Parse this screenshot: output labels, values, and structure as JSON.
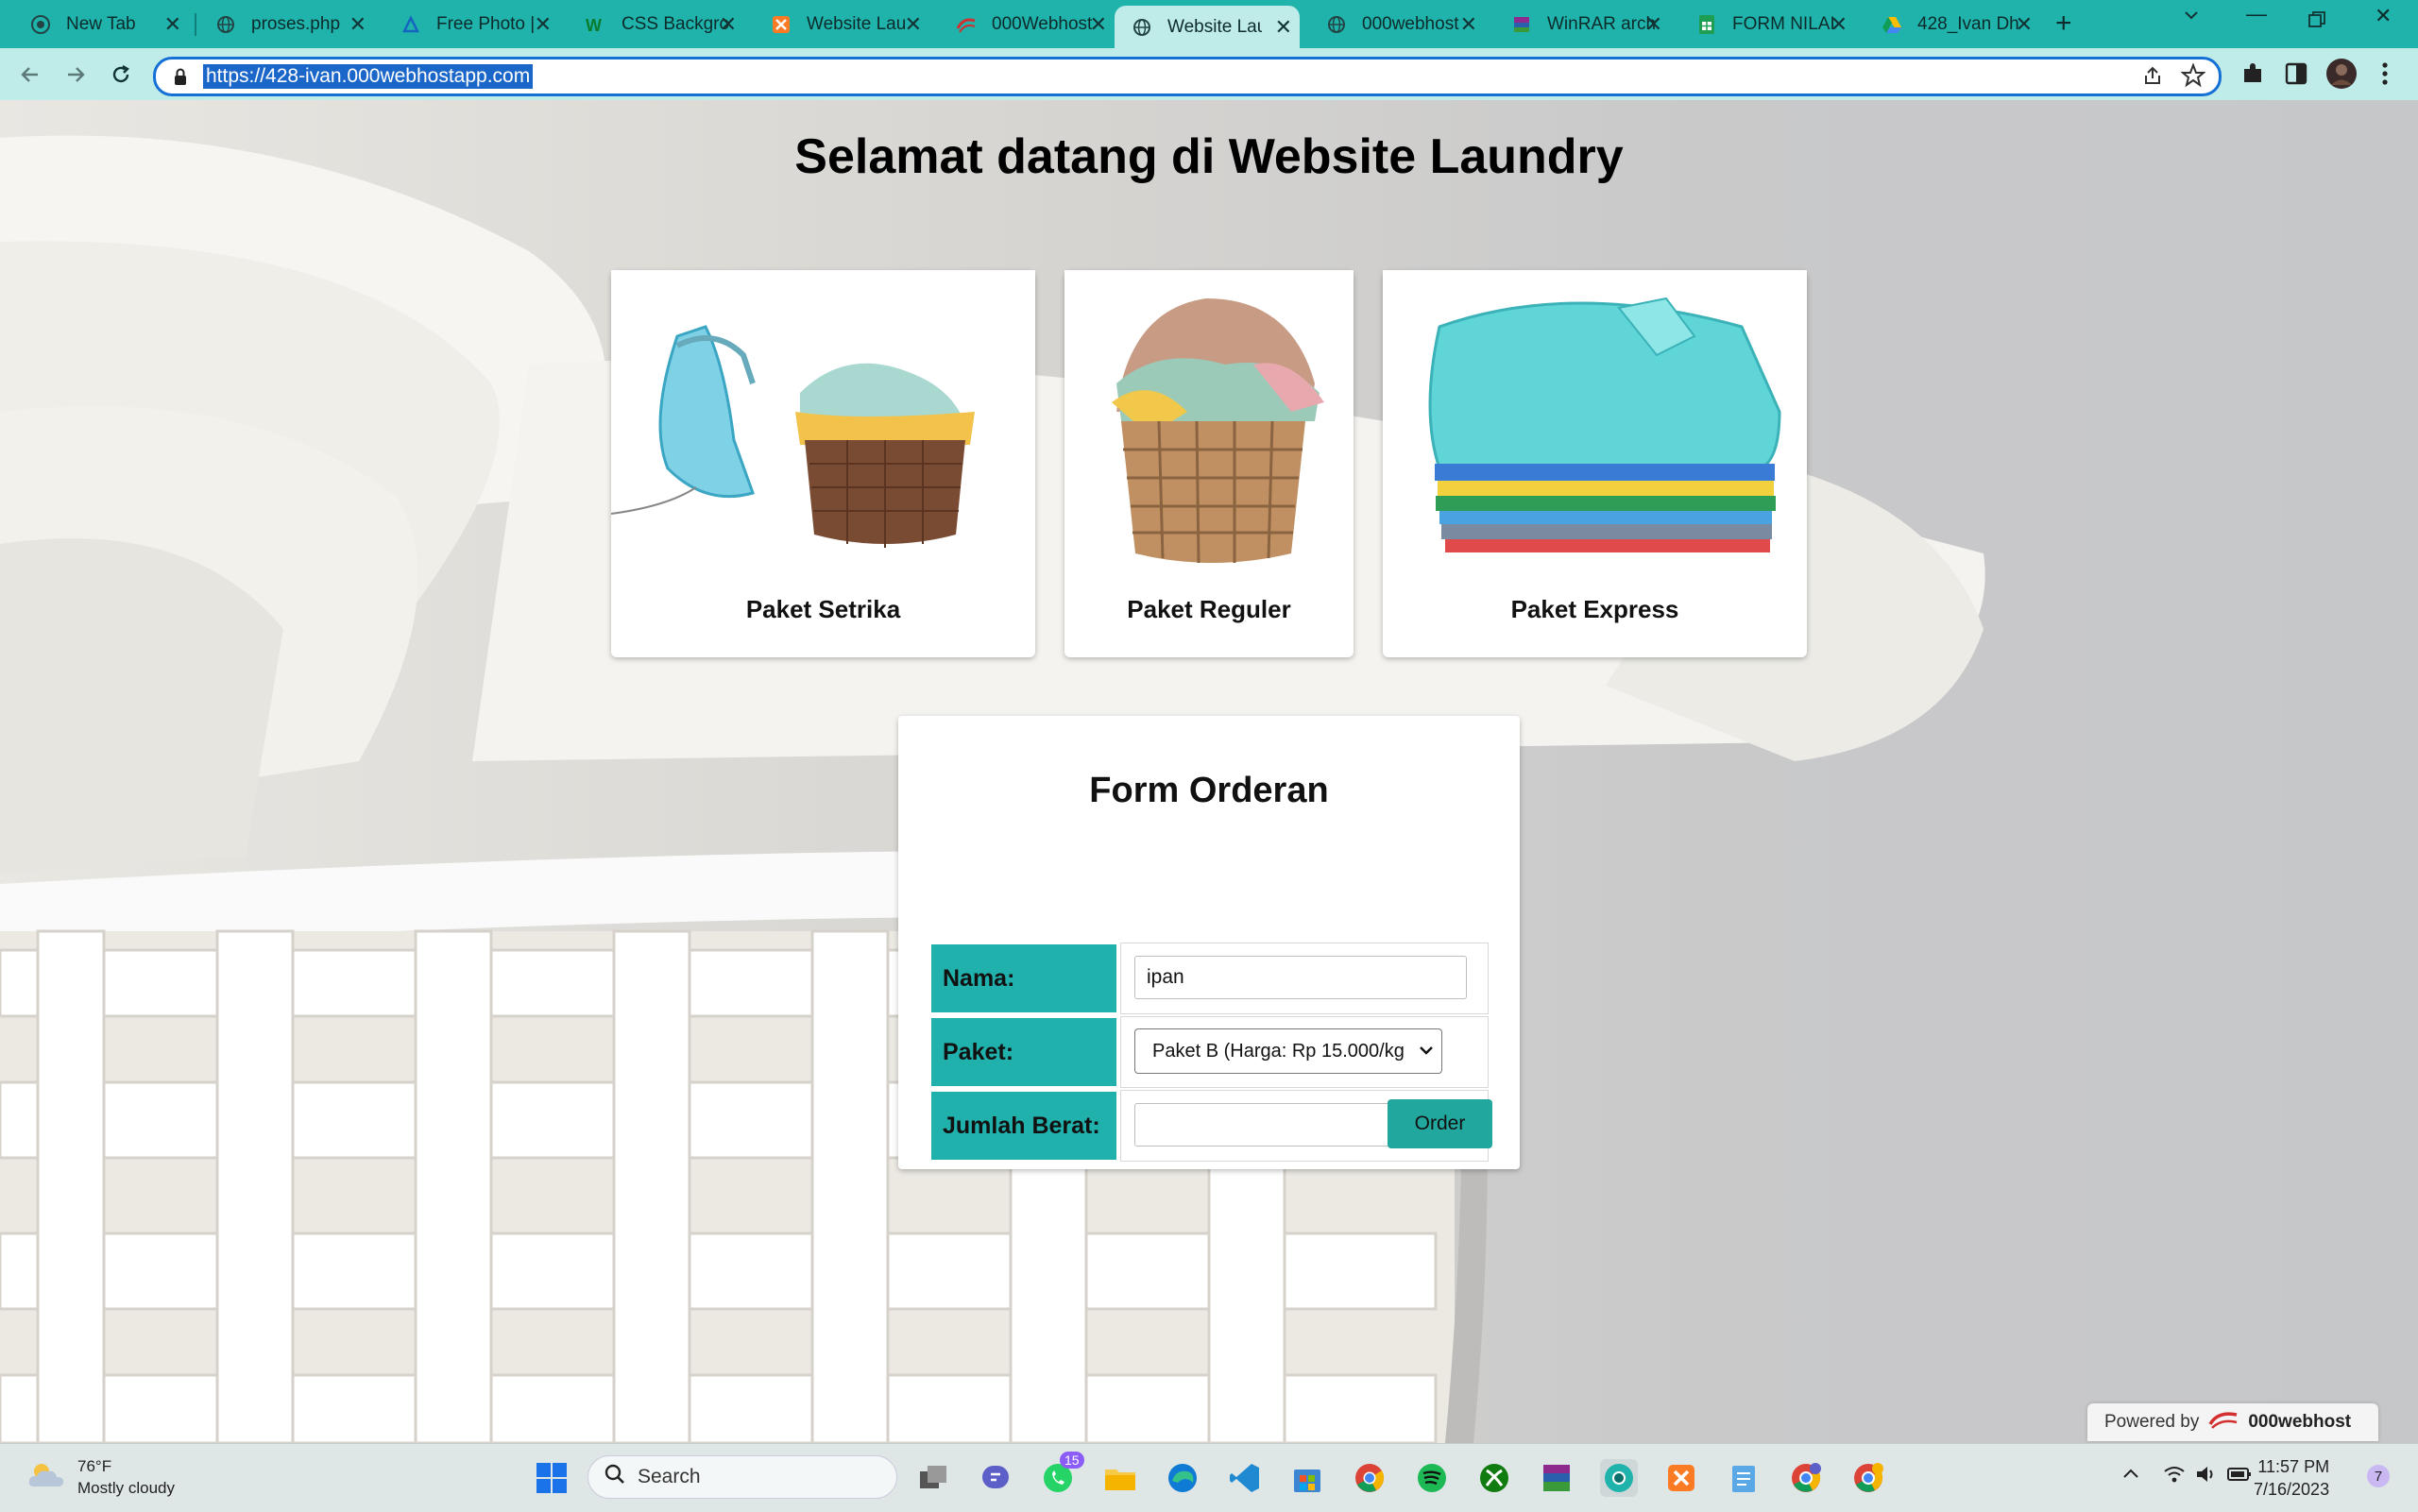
{
  "browser": {
    "tabs": [
      {
        "title": "New Tab"
      },
      {
        "title": "proses.php"
      },
      {
        "title": "Free Photo |"
      },
      {
        "title": "CSS Backgro"
      },
      {
        "title": "Website Lau"
      },
      {
        "title": "000Webhost"
      },
      {
        "title": "Website Lau"
      },
      {
        "title": "000webhost"
      },
      {
        "title": "WinRAR arch"
      },
      {
        "title": "FORM NILAI"
      },
      {
        "title": "428_Ivan Dh"
      }
    ],
    "active_tab_index": 6,
    "url": "https://428-ivan.000webhostapp.com"
  },
  "page": {
    "title": "Selamat datang di Website Laundry",
    "cards": [
      {
        "label": "Paket Setrika"
      },
      {
        "label": "Paket Reguler"
      },
      {
        "label": "Paket Express"
      }
    ],
    "form": {
      "title": "Form Orderan",
      "nama_label": "Nama:",
      "nama_value": "ipan",
      "paket_label": "Paket:",
      "paket_selected": "Paket B (Harga: Rp 15.000/kg",
      "berat_label": "Jumlah Berat:",
      "berat_value": "",
      "order_label": "Order"
    },
    "powered": {
      "prefix": "Powered by",
      "brand": "000webhost"
    }
  },
  "taskbar": {
    "weather_temp": "76°F",
    "weather_desc": "Mostly cloudy",
    "search_label": "Search",
    "whatsapp_badge": "15",
    "time": "11:57 PM",
    "date": "7/16/2023",
    "notification_count": "7"
  },
  "colors": {
    "tabbar": "#1fb3ac",
    "toolbar": "#bfece8",
    "form_label_bg": "#21b1ad",
    "order_button": "#22a79f"
  }
}
